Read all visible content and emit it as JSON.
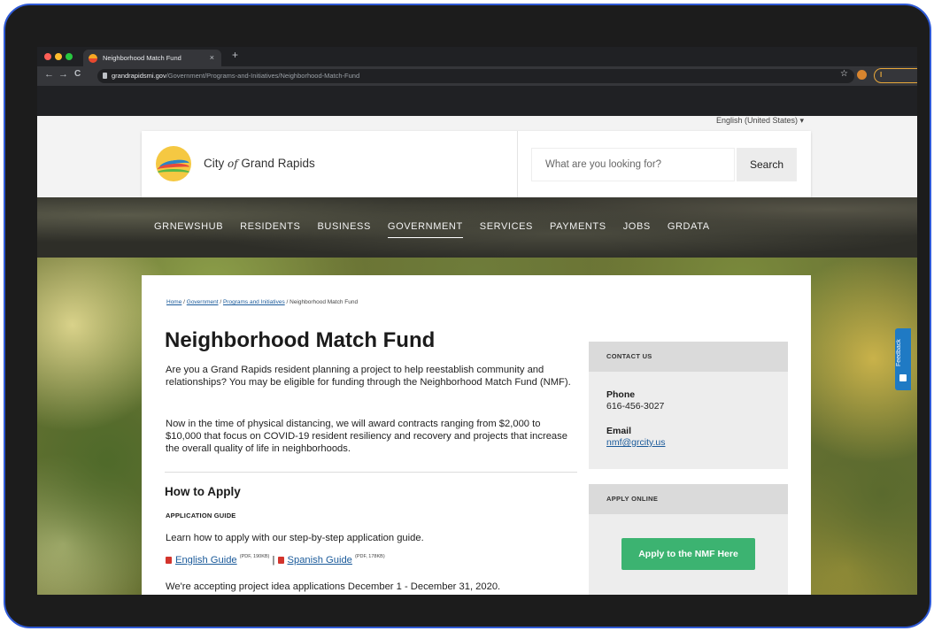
{
  "browser": {
    "tab_title": "Neighborhood Match Fund",
    "tab_close": "×",
    "new_tab": "+",
    "back": "←",
    "forward": "→",
    "reload": "C",
    "url_host": "grandrapidsmi.gov",
    "url_path": "/Government/Programs-and-Initiatives/Neighborhood-Match-Fund",
    "bookmark_star": "☆",
    "profile_initial": "I",
    "dot_colors": [
      "#ff5f57",
      "#febc2e",
      "#28c840"
    ]
  },
  "header": {
    "language": "English (United States) ▾",
    "city_name_before": "City ",
    "city_name_of": "of",
    "city_name_after": " Grand Rapids",
    "search_placeholder": "What are you looking for?",
    "search_button": "Search"
  },
  "nav": {
    "items": [
      "GRNEWSHUB",
      "RESIDENTS",
      "BUSINESS",
      "GOVERNMENT",
      "SERVICES",
      "PAYMENTS",
      "JOBS",
      "GRDATA"
    ],
    "active": "GOVERNMENT"
  },
  "breadcrumb": {
    "home": "Home",
    "government": "Government",
    "programs": "Programs and Initiatives",
    "current": "Neighborhood Match Fund",
    "separator": " / "
  },
  "main": {
    "title": "Neighborhood Match Fund",
    "intro": "Are you a Grand Rapids resident planning a project to help reestablish community and relationships? You may be eligible for funding through the Neighborhood Match Fund (NMF).",
    "covid": "Now in the time of physical distancing, we will award contracts ranging from $2,000 to $10,000 that focus on COVID-19 resident  resiliency and recovery and projects that increase the overall quality of life in neighborhoods.",
    "how_to_apply": "How to Apply",
    "guide_heading": "APPLICATION GUIDE",
    "guide_text": "Learn how to apply with our step-by-step application guide.",
    "english_guide": "English Guide",
    "english_meta": "(PDF, 190KB)",
    "link_separator": " | ",
    "spanish_guide": "Spanish Guide",
    "spanish_meta": "(PDF, 178KB)",
    "accepting": "We're accepting project idea applications December 1 - December 31, 2020."
  },
  "sidebar": {
    "contact_heading": "CONTACT US",
    "phone_label": "Phone",
    "phone_value": "616-456-3027",
    "email_label": "Email",
    "email_value": "nmf@grcity.us",
    "apply_heading": "APPLY ONLINE",
    "apply_button": "Apply to the NMF Here"
  },
  "feedback": {
    "label": "Feedback"
  }
}
